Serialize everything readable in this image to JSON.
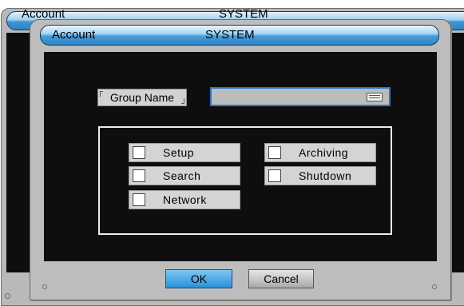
{
  "background_window": {
    "title_left": "Account",
    "title_center": "SYSTEM"
  },
  "dialog": {
    "title_left": "Account",
    "title_center": "SYSTEM",
    "group_name": {
      "label": "Group Name",
      "value": ""
    },
    "permissions": [
      {
        "label": "Setup",
        "checked": false
      },
      {
        "label": "Archiving",
        "checked": false
      },
      {
        "label": "Search",
        "checked": false
      },
      {
        "label": "Shutdown",
        "checked": false
      },
      {
        "label": "Network",
        "checked": false
      }
    ],
    "buttons": {
      "ok": "OK",
      "cancel": "Cancel"
    }
  },
  "colors": {
    "title_gradient_top": "#eaf5fc",
    "title_gradient_bottom": "#2e84c6",
    "content_bg": "#0e0e0e",
    "ok_button": "#2a8fd8",
    "input_border": "#2b78c9"
  },
  "icons": {
    "keyboard": "keyboard-icon"
  }
}
